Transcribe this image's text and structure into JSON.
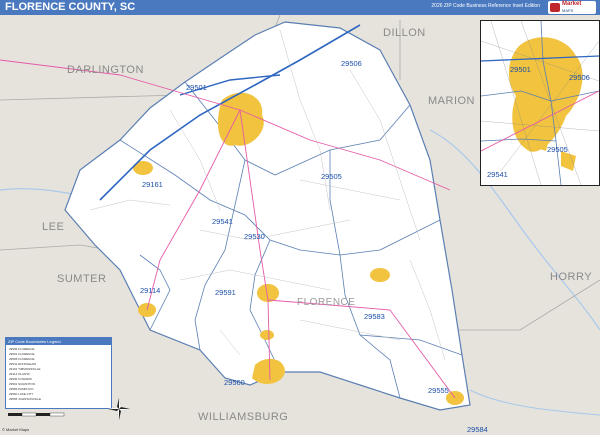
{
  "title": "FLORENCE COUNTY, SC",
  "subtitle": "2026 ZIP Code Business Reference Inset Edition",
  "logo": {
    "line1": "Market",
    "line2": "MAPS"
  },
  "county_name": "FLORENCE",
  "neighbor_counties": [
    "DARLINGTON",
    "DILLON",
    "MARION",
    "LEE",
    "SUMTER",
    "WILLIAMSBURG",
    "HORRY"
  ],
  "zip_codes": [
    "29506",
    "29501",
    "29161",
    "29505",
    "29541",
    "29530",
    "29114",
    "29591",
    "29583",
    "29560",
    "29555",
    "29584"
  ],
  "inset_zip_codes": [
    "29501",
    "29506",
    "29505",
    "29541"
  ],
  "legend": {
    "title": "ZIP Code Boundaries Legend",
    "rows": [
      "29506  FLORENCE",
      "29501  FLORENCE",
      "29505  FLORENCE",
      "29541  EFFINGHAM",
      "29161  TIMMONSVILLE",
      "29114  OLANTA",
      "29530  COWARD",
      "29591  SCRANTON",
      "29583  PAMPLICO",
      "29560  LAKE CITY",
      "29555  JOHNSONVILLE"
    ]
  },
  "colors": {
    "title_bar": "#4a79c0",
    "outside_county": "#e6e3dc",
    "county_fill": "#ffffff",
    "urban_fill": "#f1c33f",
    "zip_boundary": "#5b7fb3",
    "zip_label": "#1b4fa8",
    "interstate": "#2e66c0",
    "us_highway": "#e55aa7",
    "water": "#a8c8ec"
  },
  "icons": [
    "compass-rose-icon",
    "logo-icon"
  ],
  "copyright": "© Market Maps"
}
